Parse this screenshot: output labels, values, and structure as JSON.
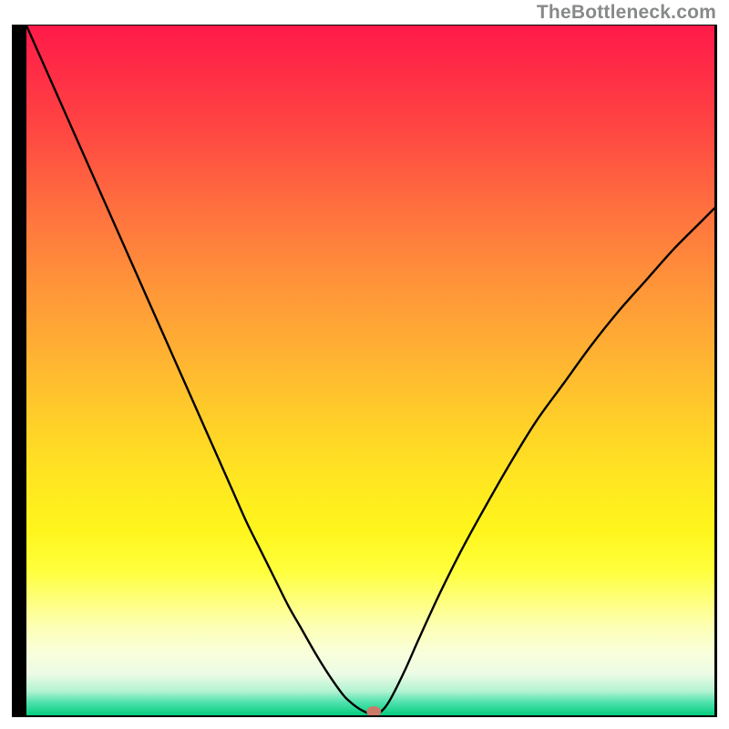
{
  "attribution": "TheBottleneck.com",
  "chart_data": {
    "type": "line",
    "title": "",
    "xlabel": "",
    "ylabel": "",
    "xlim": [
      0,
      100
    ],
    "ylim": [
      0,
      100
    ],
    "x": [
      0,
      2,
      4,
      6,
      8,
      10,
      12,
      14,
      16,
      18,
      20,
      22,
      24,
      26,
      28,
      30,
      32,
      34,
      36,
      38,
      40,
      42,
      44,
      46,
      47,
      48,
      49,
      50,
      51,
      52,
      53,
      55,
      57,
      60,
      63,
      66,
      70,
      74,
      78,
      82,
      86,
      90,
      94,
      98,
      100
    ],
    "values": [
      100,
      95.5,
      91,
      86.5,
      82,
      77.5,
      73,
      68.5,
      64,
      59.5,
      55,
      50.5,
      46,
      41.5,
      37,
      32.5,
      28,
      24,
      20,
      16,
      12.5,
      9,
      5.8,
      3,
      2,
      1.2,
      0.6,
      0.2,
      0.2,
      1,
      2.5,
      6.5,
      11,
      17.5,
      23.5,
      29,
      36,
      42.5,
      48,
      53.5,
      58.5,
      63,
      67.5,
      71.5,
      73.5
    ],
    "min_point": {
      "x": 50.5,
      "y": 0
    },
    "gradient_stops": [
      {
        "t": 0.0,
        "color": "#ff1a49"
      },
      {
        "t": 0.5,
        "color": "#ffd128"
      },
      {
        "t": 1.0,
        "color": "#05cd7e"
      }
    ]
  }
}
